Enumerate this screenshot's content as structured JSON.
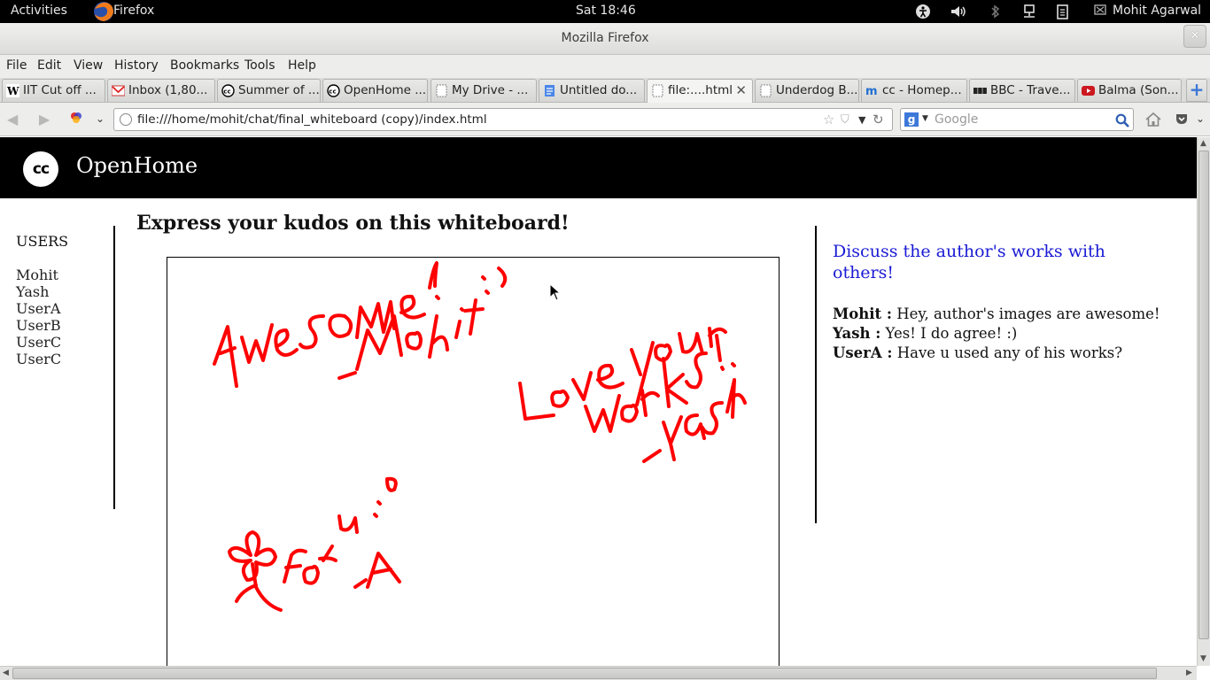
{
  "system_bar": {
    "activities": "Activities",
    "app_name": "Firefox",
    "clock": "Sat 18:46",
    "user": "Mohit Agarwal"
  },
  "window": {
    "title": "Mozilla Firefox",
    "close": "✕"
  },
  "menu": [
    "File",
    "Edit",
    "View",
    "History",
    "Bookmarks",
    "Tools",
    "Help"
  ],
  "tabs": [
    {
      "label": "IIT Cut off ...",
      "icon": "wikipedia-icon"
    },
    {
      "label": "Inbox (1,80...",
      "icon": "gmail-icon"
    },
    {
      "label": "Summer of ...",
      "icon": "cc-icon"
    },
    {
      "label": "OpenHome ...",
      "icon": "cc-icon"
    },
    {
      "label": "My Drive - ...",
      "icon": "blank-page-icon"
    },
    {
      "label": "Untitled do...",
      "icon": "google-docs-icon"
    },
    {
      "label": "file:....html",
      "icon": "blank-page-icon",
      "active": true
    },
    {
      "label": "Underdog B...",
      "icon": "blank-page-icon"
    },
    {
      "label": "cc - Homep...",
      "icon": "m-icon"
    },
    {
      "label": "BBC - Trave...",
      "icon": "bbc-icon"
    },
    {
      "label": "Balma (Son...",
      "icon": "youtube-icon"
    }
  ],
  "nav": {
    "url": "file:///home/mohit/chat/final_whiteboard (copy)/index.html",
    "search_placeholder": "Google",
    "search_engine": "g"
  },
  "page": {
    "logo_text": "cc",
    "brand": "OpenHome",
    "users_heading": "USERS",
    "users": [
      "Mohit",
      "Yash",
      "UserA",
      "UserB",
      "UserC",
      "UserC"
    ],
    "whiteboard_title": "Express your kudos on this whiteboard!",
    "discuss_title": "Discuss the author's works with others!",
    "chat": [
      {
        "user": "Mohit :",
        "message": " Hey, author's images are awesome!"
      },
      {
        "user": "Yash :",
        "message": " Yes! I do agree! :)"
      },
      {
        "user": "UserA :",
        "message": " Have u used any of his works?"
      }
    ],
    "ink_color": "#ff0000"
  },
  "colors": {
    "header_bg": "#000000",
    "discuss_link": "#1a1ad4"
  }
}
